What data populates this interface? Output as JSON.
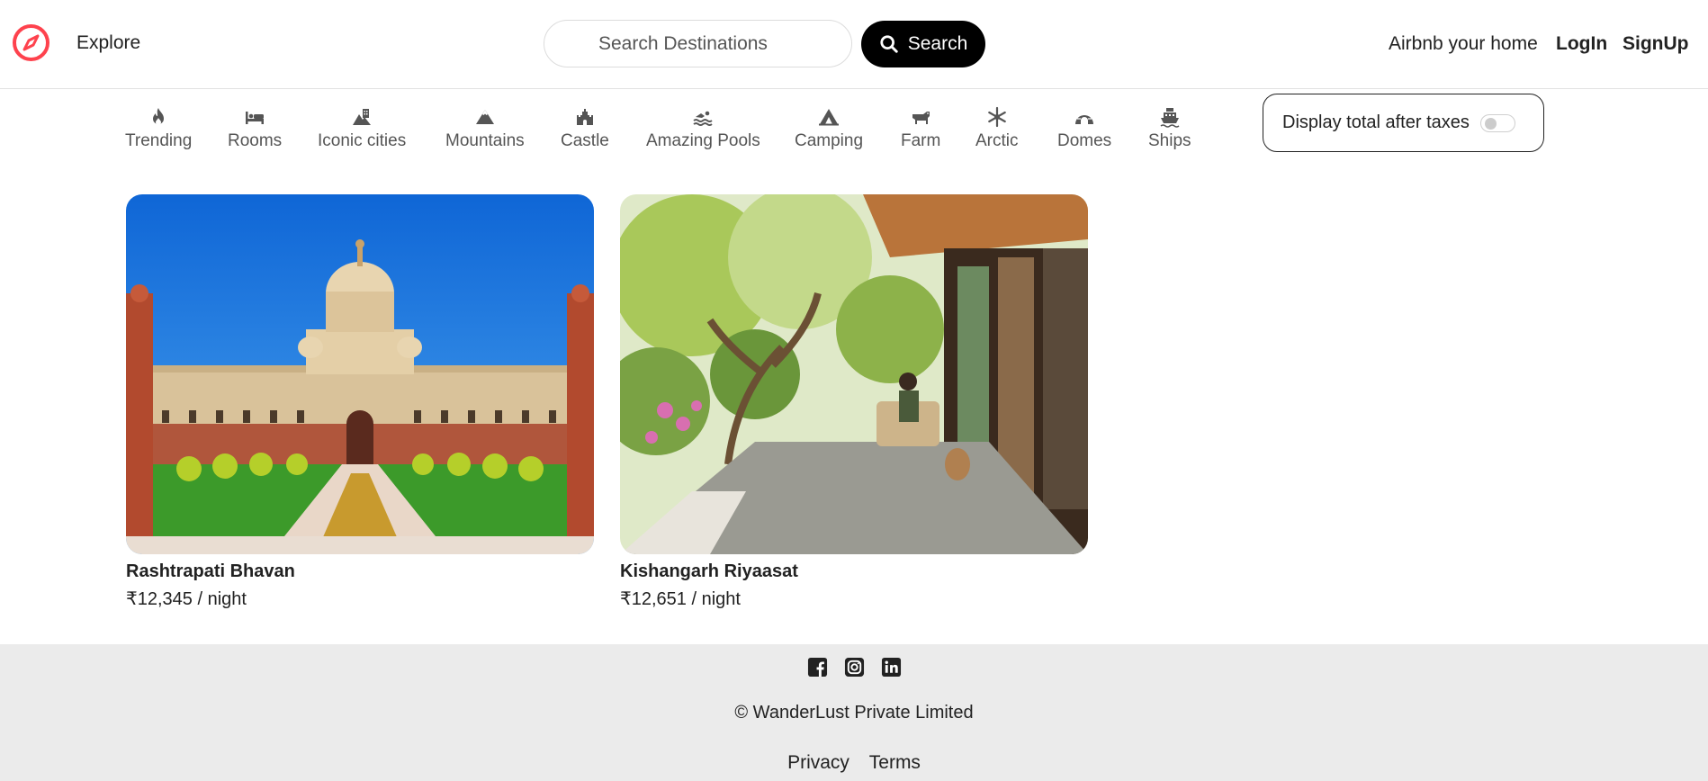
{
  "brand": {
    "accent": "#fe424d"
  },
  "nav": {
    "explore": "Explore",
    "search_placeholder": "Search Destinations",
    "search_button": "Search",
    "airbnb_home": "Airbnb your home",
    "login": "LogIn",
    "signup": "SignUp"
  },
  "filters": [
    {
      "label": "Trending",
      "icon": "fire-icon"
    },
    {
      "label": "Rooms",
      "icon": "bed-icon"
    },
    {
      "label": "Iconic cities",
      "icon": "city-icon"
    },
    {
      "label": "Mountains",
      "icon": "mountain-icon"
    },
    {
      "label": "Castle",
      "icon": "castle-icon"
    },
    {
      "label": "Amazing Pools",
      "icon": "swimmer-icon"
    },
    {
      "label": "Camping",
      "icon": "campground-icon"
    },
    {
      "label": "Farm",
      "icon": "cow-icon"
    },
    {
      "label": "Arctic",
      "icon": "snowflake-icon"
    },
    {
      "label": "Domes",
      "icon": "igloo-icon"
    },
    {
      "label": "Ships",
      "icon": "ship-icon"
    }
  ],
  "tax_toggle": {
    "label": "Display total after taxes",
    "enabled": false
  },
  "listings": [
    {
      "title": "Rashtrapati Bhavan",
      "price": "₹12,345 / night"
    },
    {
      "title": "Kishangarh Riyaasat",
      "price": "₹12,651 / night"
    }
  ],
  "footer": {
    "socials": [
      "facebook-icon",
      "instagram-icon",
      "linkedin-icon"
    ],
    "copyright": "© WanderLust Private Limited",
    "privacy": "Privacy",
    "terms": "Terms"
  }
}
